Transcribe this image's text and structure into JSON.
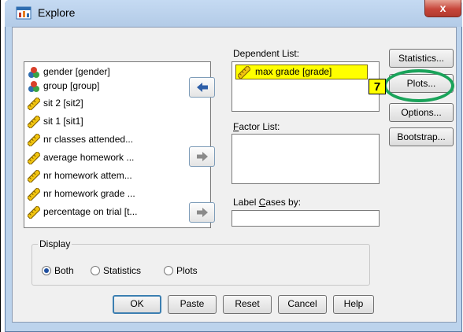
{
  "window": {
    "title": "Explore",
    "close_label": "x"
  },
  "variables": [
    {
      "label": "gender [gender]",
      "icon": "nominal-icon"
    },
    {
      "label": "group [group]",
      "icon": "nominal-icon"
    },
    {
      "label": "sit 2 [sit2]",
      "icon": "scale-icon"
    },
    {
      "label": "sit 1 [sit1]",
      "icon": "scale-icon"
    },
    {
      "label": "nr classes attended...",
      "icon": "scale-icon"
    },
    {
      "label": "average homework ...",
      "icon": "scale-icon"
    },
    {
      "label": "nr homework attem...",
      "icon": "scale-icon"
    },
    {
      "label": "nr homework grade ...",
      "icon": "scale-icon"
    },
    {
      "label": "percentage on trial [t...",
      "icon": "scale-icon"
    }
  ],
  "dependent": {
    "label": "Dependent List:",
    "items": [
      "max grade [grade]"
    ]
  },
  "factor": {
    "label_pre": "",
    "label_ul": "F",
    "label_post": "actor List:"
  },
  "label_cases": {
    "label_pre": "Label ",
    "label_ul": "C",
    "label_post": "ases by:"
  },
  "side_buttons": {
    "statistics": "Statistics...",
    "plots": "Plots...",
    "options": "Options...",
    "bootstrap": "Bootstrap..."
  },
  "annotation": {
    "step": "7"
  },
  "display": {
    "legend": "Display",
    "both": "Both",
    "statistics": "Statistics",
    "plots": "Plots",
    "selected": "Both"
  },
  "bottom_buttons": {
    "ok": "OK",
    "paste": "Paste",
    "reset": "Reset",
    "cancel": "Cancel",
    "help": "Help"
  },
  "colors": {
    "highlight": "#ffff00",
    "annotation_ring": "#1aa35a",
    "arrow_active": "#2e5fa8",
    "arrow_inactive": "#8a8a8a"
  }
}
